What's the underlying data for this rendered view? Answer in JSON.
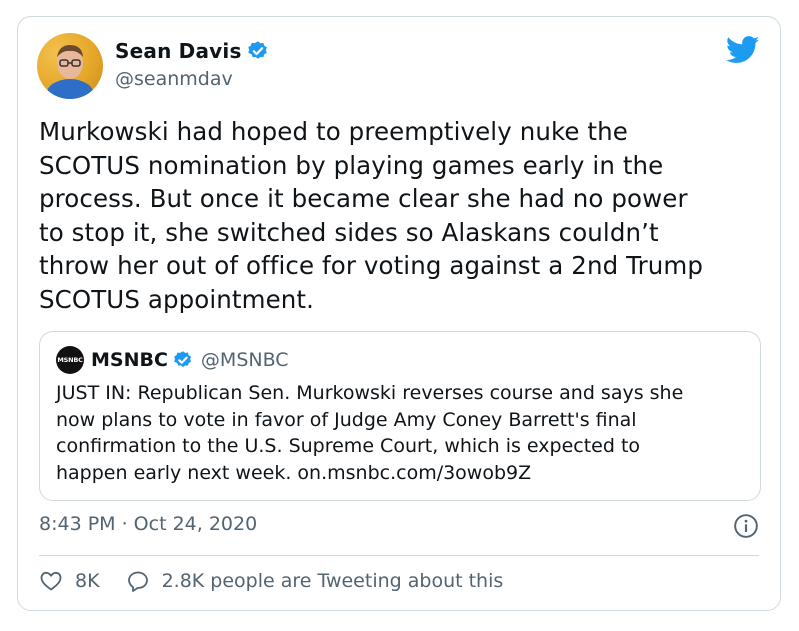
{
  "tweet": {
    "author": {
      "name": "Sean Davis",
      "handle": "@seanmdav"
    },
    "text": "Murkowski had hoped to preemptively nuke the\nSCOTUS nomination by playing games early in the\nprocess. But once it became clear she had no power\nto stop it, she switched sides so Alaskans couldn’t\nthrow her out of office for voting against a 2nd Trump\nSCOTUS appointment.",
    "timestamp": "8:43 PM · Oct 24, 2020",
    "likes": "8K",
    "tweeting_about": "2.8K people are Tweeting about this"
  },
  "quoted": {
    "avatar_label": "MSNBC",
    "name": "MSNBC",
    "handle": "@MSNBC",
    "text": "JUST IN: Republican Sen. Murkowski reverses course and says she\nnow plans to vote in favor of Judge Amy Coney Barrett's final\nconfirmation to the U.S. Supreme Court, which is expected to\nhappen early next week. on.msnbc.com/3owob9Z"
  },
  "icons": {
    "verified": "verified-badge-icon",
    "brand": "twitter-bird-icon",
    "info": "info-icon",
    "like": "heart-icon",
    "reply": "speech-bubble-icon"
  },
  "colors": {
    "brand": "#1d9bf0",
    "text": "#0f1419",
    "secondary": "#536471",
    "border": "#cfd9de"
  }
}
